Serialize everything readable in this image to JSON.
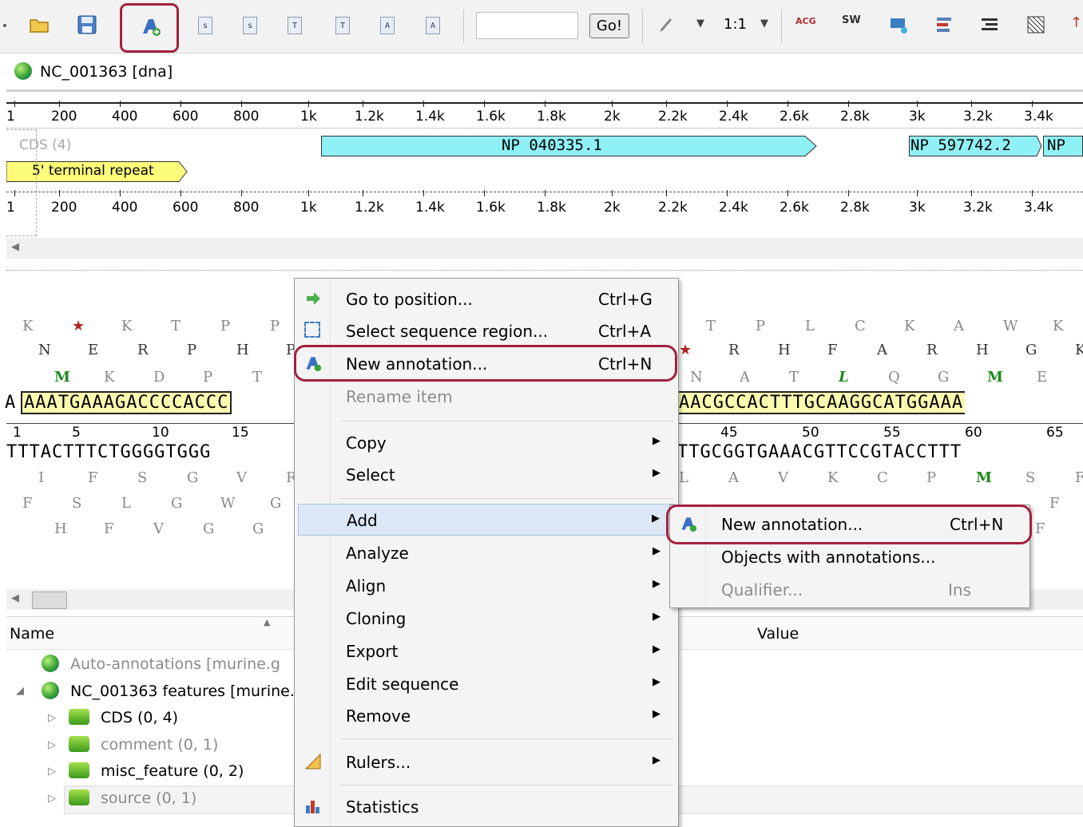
{
  "toolbar": {
    "go_label": "Go!",
    "zoom_label": "1:1",
    "search_placeholder": "",
    "acg_label": "ACG",
    "sw_label": "SW"
  },
  "sequence": {
    "title": "NC_001363 [dna]",
    "ruler_ticks": [
      "1",
      "200",
      "400",
      "600",
      "800",
      "1k",
      "1.2k",
      "1.4k",
      "1.6k",
      "1.8k",
      "2k",
      "2.2k",
      "2.4k",
      "2.6k",
      "2.8k",
      "3k",
      "3.2k",
      "3.4k"
    ],
    "cds_track_label": "CDS (4)",
    "annotations": [
      "NP 040335.1",
      "NP 597742.2",
      "NP"
    ],
    "repeat_label": "5' terminal repeat"
  },
  "detail": {
    "frame1_left": [
      "K",
      "★",
      "K",
      "T",
      "P",
      "P"
    ],
    "frame2_left": [
      "N",
      "E",
      "R",
      "P",
      "H",
      "P"
    ],
    "frame3_left": [
      "M",
      "K",
      "D",
      "P",
      "T"
    ],
    "frame1_right": [
      "T",
      "P",
      "L",
      "C",
      "K",
      "A",
      "W",
      "K"
    ],
    "frame2_right": [
      "★",
      "R",
      "H",
      "F",
      "A",
      "R",
      "H",
      "G",
      "K"
    ],
    "frame3_right": [
      "N",
      "A",
      "T",
      "L",
      "Q",
      "G",
      "M",
      "E"
    ],
    "forward_left": "AAATGAAAGACCCCACCC",
    "forward_right": "AACGCCACTTTGCAAGGCATGGAAA",
    "positions_left": [
      "1",
      "5",
      "10",
      "15"
    ],
    "positions_right": [
      "45",
      "50",
      "55",
      "60",
      "65"
    ],
    "reverse_left": "TTTACTTTCTGGGGTGGG",
    "reverse_right": "TTGCGGTGAAACGTTCCGTACCTTT",
    "rframe1_left": [
      "I",
      "F",
      "S",
      "G",
      "V",
      "R"
    ],
    "rframe2_left": [
      "F",
      "S",
      "L",
      "G",
      "W",
      "G"
    ],
    "rframe3_left": [
      "H",
      "F",
      "V",
      "G",
      "G"
    ],
    "rframe1_right": [
      "L",
      "A",
      "V",
      "K",
      "C",
      "P",
      "M",
      "S",
      "F"
    ],
    "rframe2_right": [
      "F"
    ],
    "rframe3_right": [
      "F"
    ]
  },
  "tree": {
    "col_name": "Name",
    "col_value": "Value",
    "rows": [
      {
        "label": "Auto-annotations [murine.g"
      },
      {
        "label": "NC_001363 features [murine."
      },
      {
        "label": "CDS",
        "count": "(0, 4)"
      },
      {
        "label": "comment",
        "count": "(0, 1)"
      },
      {
        "label": "misc_feature",
        "count": "(0, 2)"
      },
      {
        "label": "source",
        "count": "(0, 1)"
      }
    ]
  },
  "context_menu": {
    "items": [
      {
        "label": "Go to position...",
        "shortcut": "Ctrl+G"
      },
      {
        "label": "Select sequence region...",
        "shortcut": "Ctrl+A"
      },
      {
        "label": "New annotation...",
        "shortcut": "Ctrl+N"
      },
      {
        "label": "Rename item"
      },
      {
        "label": "Copy"
      },
      {
        "label": "Select"
      },
      {
        "label": "Add"
      },
      {
        "label": "Analyze"
      },
      {
        "label": "Align"
      },
      {
        "label": "Cloning"
      },
      {
        "label": "Export"
      },
      {
        "label": "Edit sequence"
      },
      {
        "label": "Remove"
      },
      {
        "label": "Rulers..."
      },
      {
        "label": "Statistics"
      }
    ]
  },
  "submenu": {
    "items": [
      {
        "label": "New annotation...",
        "shortcut": "Ctrl+N"
      },
      {
        "label": "Objects with annotations..."
      },
      {
        "label": "Qualifier...",
        "shortcut": "Ins"
      }
    ]
  },
  "colors": {
    "highlight": "#a3213f",
    "cds": "#8ff0f5",
    "repeat": "#fcfc7a"
  }
}
